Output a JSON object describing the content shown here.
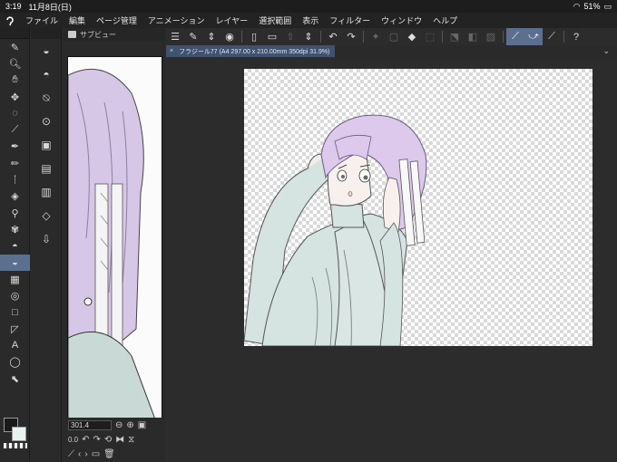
{
  "status": {
    "time": "3:19",
    "date": "11月8日(日)",
    "battery": "51%"
  },
  "menu": {
    "items": [
      "ファイル",
      "編集",
      "ページ管理",
      "アニメーション",
      "レイヤー",
      "選択範囲",
      "表示",
      "フィルター",
      "ウィンドウ",
      "ヘルプ"
    ]
  },
  "subview": {
    "title": "サブビュー",
    "zoom": "301.4",
    "rotation": "0.0"
  },
  "document": {
    "tab_label": "フラジール77 (A4 297.00 x 210.00mm 350dpi 31.9%)"
  },
  "icons": {
    "tools": [
      "pen-tool-icon",
      "zoom-icon",
      "hand-move-icon",
      "layer-move-icon",
      "lasso-select-icon",
      "eyedropper-icon",
      "pen-icon",
      "pencil-icon",
      "brush-icon",
      "eraser-icon",
      "airbrush-icon",
      "decoration-icon",
      "blend-icon",
      "fill-icon",
      "gradient-icon",
      "figure-icon",
      "frame-icon",
      "ruler-icon",
      "text-icon",
      "balloon-icon",
      "correct-line-icon"
    ],
    "subtools": [
      "fill-subtool-icon",
      "enclose-fill-icon",
      "paint-unfilled-icon",
      "target-icon",
      "layer-icon",
      "quick-access-icon",
      "timeline-icon",
      "layers-icon",
      "import-icon"
    ]
  },
  "colors": {
    "accent": "#5b6f8f",
    "tab": "#41526f",
    "foreground": "#1a1a1a",
    "background": "#e8f2f1"
  }
}
